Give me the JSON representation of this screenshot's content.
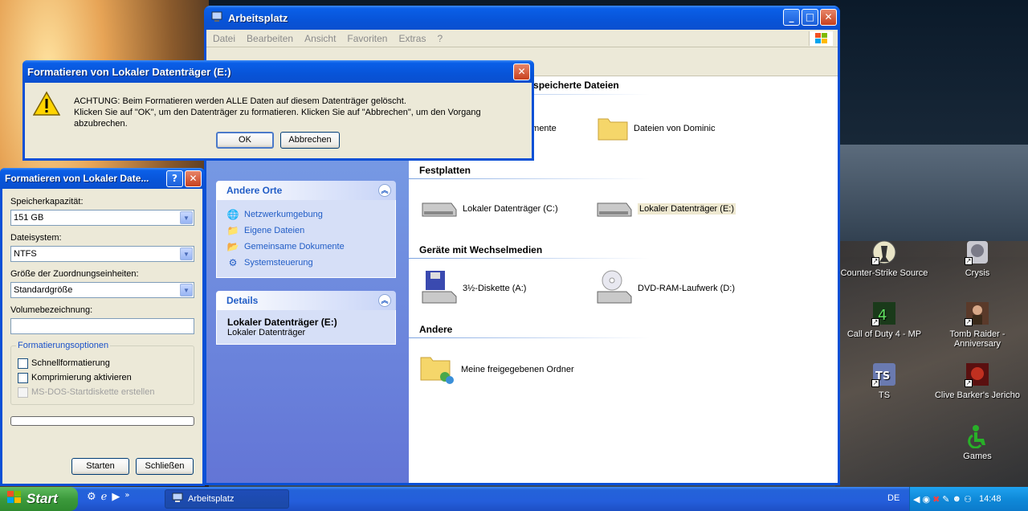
{
  "explorer": {
    "title": "Arbeitsplatz",
    "menu": [
      "Datei",
      "Bearbeiten",
      "Ansicht",
      "Favoriten",
      "Extras",
      "?"
    ],
    "panes": {
      "other_places": {
        "title": "Andere Orte",
        "links": [
          "Netzwerkumgebung",
          "Eigene Dateien",
          "Gemeinsame Dokumente",
          "Systemsteuerung"
        ]
      },
      "details": {
        "title": "Details",
        "name": "Lokaler Datenträger (E:)",
        "type": "Lokaler Datenträger"
      }
    },
    "groups": {
      "stored_files": "Auf diesem Computer gespeicherte Dateien",
      "hard_drives": "Festplatten",
      "removable": "Geräte mit Wechselmedien",
      "other": "Andere"
    },
    "items": {
      "shared_docs": "Gemeinsame Dokumente",
      "dominic": "Dateien von Dominic",
      "drive_c": "Lokaler Datenträger (C:)",
      "drive_e": "Lokaler Datenträger (E:)",
      "floppy": "3½-Diskette (A:)",
      "dvd": "DVD-RAM-Laufwerk (D:)",
      "shared_folders": "Meine freigegebenen Ordner"
    }
  },
  "format_dialog": {
    "title": "Formatieren von Lokaler Date...",
    "capacity_label": "Speicherkapazität:",
    "capacity_value": "151 GB",
    "fs_label": "Dateisystem:",
    "fs_value": "NTFS",
    "alloc_label": "Größe der Zuordnungseinheiten:",
    "alloc_value": "Standardgröße",
    "volume_label": "Volumebezeichnung:",
    "volume_value": "",
    "options_title": "Formatierungsoptionen",
    "opt_quick": "Schnellformatierung",
    "opt_compress": "Komprimierung aktivieren",
    "opt_msdos": "MS-DOS-Startdiskette erstellen",
    "progress": 0,
    "start": "Starten",
    "close": "Schließen"
  },
  "confirm_dialog": {
    "title": "Formatieren von Lokaler Datenträger (E:)",
    "line1": "ACHTUNG: Beim Formatieren werden ALLE Daten auf diesem Datenträger gelöscht.",
    "line2": "Klicken Sie auf \"OK\", um den Datenträger zu formatieren. Klicken Sie auf \"Abbrechen\", um den Vorgang abzubrechen.",
    "ok": "OK",
    "cancel": "Abbrechen"
  },
  "desktop": {
    "icons": [
      "Counter-Strike Source",
      "Crysis",
      "Call of Duty 4 - MP",
      "Tomb Raider - Anniversary",
      "TS",
      "Clive Barker's Jericho",
      "Games"
    ]
  },
  "taskbar": {
    "start": "Start",
    "task": "Arbeitsplatz",
    "lang": "DE",
    "time": "14:48"
  },
  "colors": {
    "xp_blue": "#0a50d6",
    "dialog_bg": "#ece9d8",
    "link": "#215dc6"
  }
}
